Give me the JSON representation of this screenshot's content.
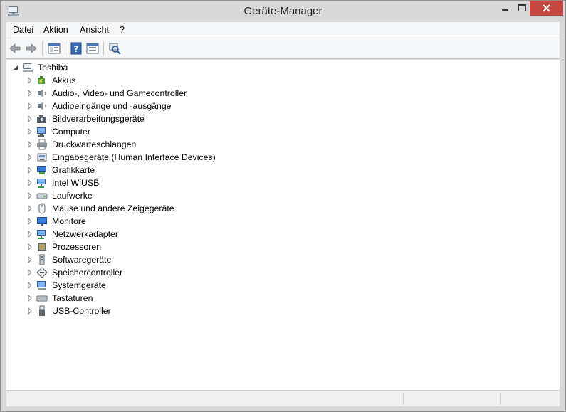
{
  "window": {
    "title": "Geräte-Manager"
  },
  "menu": {
    "datei": "Datei",
    "aktion": "Aktion",
    "ansicht": "Ansicht",
    "hilfe": "?"
  },
  "tree": {
    "root": "Toshiba",
    "categories": [
      {
        "label": "Akkus",
        "icon": "battery-icon"
      },
      {
        "label": "Audio-, Video- und Gamecontroller",
        "icon": "speaker-icon"
      },
      {
        "label": "Audioeingänge und -ausgänge",
        "icon": "speaker-icon"
      },
      {
        "label": "Bildverarbeitungsgeräte",
        "icon": "camera-icon"
      },
      {
        "label": "Computer",
        "icon": "computer-icon"
      },
      {
        "label": "Druckwarteschlangen",
        "icon": "printer-icon"
      },
      {
        "label": "Eingabegeräte (Human Interface Devices)",
        "icon": "hid-icon"
      },
      {
        "label": "Grafikkarte",
        "icon": "display-adapter-icon"
      },
      {
        "label": "Intel WiUSB",
        "icon": "network-icon"
      },
      {
        "label": "Laufwerke",
        "icon": "disk-drive-icon"
      },
      {
        "label": "Mäuse und andere Zeigegeräte",
        "icon": "mouse-icon"
      },
      {
        "label": "Monitore",
        "icon": "monitor-icon"
      },
      {
        "label": "Netzwerkadapter",
        "icon": "network-icon"
      },
      {
        "label": "Prozessoren",
        "icon": "processor-icon"
      },
      {
        "label": "Softwaregeräte",
        "icon": "software-device-icon"
      },
      {
        "label": "Speichercontroller",
        "icon": "storage-controller-icon"
      },
      {
        "label": "Systemgeräte",
        "icon": "system-device-icon"
      },
      {
        "label": "Tastaturen",
        "icon": "keyboard-icon"
      },
      {
        "label": "USB-Controller",
        "icon": "usb-icon"
      }
    ]
  },
  "colors": {
    "close_button": "#c7463f",
    "window_frame": "#d8d8d8",
    "panel_bg": "#ffffff"
  }
}
